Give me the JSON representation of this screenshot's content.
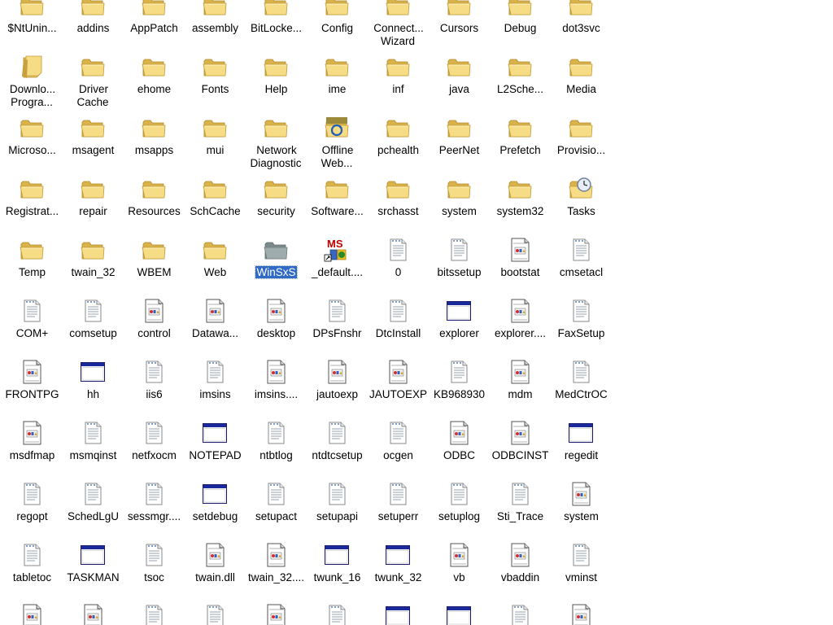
{
  "window": {
    "selected_item": "WinSxS"
  },
  "items": [
    {
      "label": "$NtUnin...",
      "icon": "folder-icon"
    },
    {
      "label": "addins",
      "icon": "folder-icon"
    },
    {
      "label": "AppPatch",
      "icon": "folder-icon"
    },
    {
      "label": "assembly",
      "icon": "folder-icon"
    },
    {
      "label": "BitLocke...",
      "icon": "folder-icon"
    },
    {
      "label": "Config",
      "icon": "folder-icon"
    },
    {
      "label": "Connect... Wizard",
      "icon": "folder-icon"
    },
    {
      "label": "Cursors",
      "icon": "folder-icon"
    },
    {
      "label": "Debug",
      "icon": "folder-icon"
    },
    {
      "label": "dot3svc",
      "icon": "folder-icon"
    },
    {
      "label": "Downlo... Progra...",
      "icon": "special-folder-icon"
    },
    {
      "label": "Driver Cache",
      "icon": "folder-icon"
    },
    {
      "label": "ehome",
      "icon": "folder-icon"
    },
    {
      "label": "Fonts",
      "icon": "folder-icon"
    },
    {
      "label": "Help",
      "icon": "folder-icon"
    },
    {
      "label": "ime",
      "icon": "folder-icon"
    },
    {
      "label": "inf",
      "icon": "folder-icon"
    },
    {
      "label": "java",
      "icon": "folder-icon"
    },
    {
      "label": "L2Sche...",
      "icon": "folder-icon"
    },
    {
      "label": "Media",
      "icon": "folder-icon"
    },
    {
      "label": "Microso...",
      "icon": "folder-icon"
    },
    {
      "label": "msagent",
      "icon": "folder-icon"
    },
    {
      "label": "msapps",
      "icon": "folder-icon"
    },
    {
      "label": "mui",
      "icon": "folder-icon"
    },
    {
      "label": "Network Diagnostic",
      "icon": "folder-icon"
    },
    {
      "label": "Offline Web...",
      "icon": "offline-web-folder-icon"
    },
    {
      "label": "pchealth",
      "icon": "folder-icon"
    },
    {
      "label": "PeerNet",
      "icon": "folder-icon"
    },
    {
      "label": "Prefetch",
      "icon": "folder-icon"
    },
    {
      "label": "Provisio...",
      "icon": "folder-icon"
    },
    {
      "label": "Registrat...",
      "icon": "folder-icon"
    },
    {
      "label": "repair",
      "icon": "folder-icon"
    },
    {
      "label": "Resources",
      "icon": "folder-icon"
    },
    {
      "label": "SchCache",
      "icon": "folder-icon"
    },
    {
      "label": "security",
      "icon": "folder-icon"
    },
    {
      "label": "Software...",
      "icon": "folder-icon"
    },
    {
      "label": "srchasst",
      "icon": "folder-icon"
    },
    {
      "label": "system",
      "icon": "folder-icon"
    },
    {
      "label": "system32",
      "icon": "folder-icon"
    },
    {
      "label": "Tasks",
      "icon": "scheduled-tasks-folder-icon"
    },
    {
      "label": "Temp",
      "icon": "folder-icon"
    },
    {
      "label": "twain_32",
      "icon": "folder-icon"
    },
    {
      "label": "WBEM",
      "icon": "folder-icon"
    },
    {
      "label": "Web",
      "icon": "folder-icon"
    },
    {
      "label": "WinSxS",
      "icon": "gray-folder-icon"
    },
    {
      "label": "_default....",
      "icon": "msi-package-icon"
    },
    {
      "label": "0",
      "icon": "text-file-icon"
    },
    {
      "label": "bitssetup",
      "icon": "text-file-icon"
    },
    {
      "label": "bootstat",
      "icon": "system-file-icon"
    },
    {
      "label": "cmsetacl",
      "icon": "text-file-icon"
    },
    {
      "label": "COM+",
      "icon": "text-file-icon"
    },
    {
      "label": "comsetup",
      "icon": "text-file-icon"
    },
    {
      "label": "control",
      "icon": "system-file-icon"
    },
    {
      "label": "Datawa...",
      "icon": "system-file-icon"
    },
    {
      "label": "desktop",
      "icon": "system-file-icon"
    },
    {
      "label": "DPsFnshr",
      "icon": "text-file-icon"
    },
    {
      "label": "DtcInstall",
      "icon": "text-file-icon"
    },
    {
      "label": "explorer",
      "icon": "application-icon"
    },
    {
      "label": "explorer....",
      "icon": "system-file-icon"
    },
    {
      "label": "FaxSetup",
      "icon": "text-file-icon"
    },
    {
      "label": "FRONTPG",
      "icon": "system-file-icon"
    },
    {
      "label": "hh",
      "icon": "application-icon"
    },
    {
      "label": "iis6",
      "icon": "text-file-icon"
    },
    {
      "label": "imsins",
      "icon": "text-file-icon"
    },
    {
      "label": "imsins....",
      "icon": "system-file-icon"
    },
    {
      "label": "jautoexp",
      "icon": "system-file-icon"
    },
    {
      "label": "JAUTOEXP",
      "icon": "system-file-icon"
    },
    {
      "label": "KB968930",
      "icon": "text-file-icon"
    },
    {
      "label": "mdm",
      "icon": "system-file-icon"
    },
    {
      "label": "MedCtrOC",
      "icon": "text-file-icon"
    },
    {
      "label": "msdfmap",
      "icon": "system-file-icon"
    },
    {
      "label": "msmqinst",
      "icon": "text-file-icon"
    },
    {
      "label": "netfxocm",
      "icon": "text-file-icon"
    },
    {
      "label": "NOTEPAD",
      "icon": "application-icon"
    },
    {
      "label": "ntbtlog",
      "icon": "text-file-icon"
    },
    {
      "label": "ntdtcsetup",
      "icon": "text-file-icon"
    },
    {
      "label": "ocgen",
      "icon": "text-file-icon"
    },
    {
      "label": "ODBC",
      "icon": "system-file-icon"
    },
    {
      "label": "ODBCINST",
      "icon": "system-file-icon"
    },
    {
      "label": "regedit",
      "icon": "application-icon"
    },
    {
      "label": "regopt",
      "icon": "text-file-icon"
    },
    {
      "label": "SchedLgU",
      "icon": "text-file-icon"
    },
    {
      "label": "sessmgr....",
      "icon": "text-file-icon"
    },
    {
      "label": "setdebug",
      "icon": "application-icon"
    },
    {
      "label": "setupact",
      "icon": "text-file-icon"
    },
    {
      "label": "setupapi",
      "icon": "text-file-icon"
    },
    {
      "label": "setuperr",
      "icon": "text-file-icon"
    },
    {
      "label": "setuplog",
      "icon": "text-file-icon"
    },
    {
      "label": "Sti_Trace",
      "icon": "text-file-icon"
    },
    {
      "label": "system",
      "icon": "system-file-icon"
    },
    {
      "label": "tabletoc",
      "icon": "text-file-icon"
    },
    {
      "label": "TASKMAN",
      "icon": "application-icon"
    },
    {
      "label": "tsoc",
      "icon": "text-file-icon"
    },
    {
      "label": "twain.dll",
      "icon": "system-file-icon"
    },
    {
      "label": "twain_32....",
      "icon": "system-file-icon"
    },
    {
      "label": "twunk_16",
      "icon": "application-icon"
    },
    {
      "label": "twunk_32",
      "icon": "application-icon"
    },
    {
      "label": "vb",
      "icon": "system-file-icon"
    },
    {
      "label": "vbaddin",
      "icon": "system-file-icon"
    },
    {
      "label": "vminst",
      "icon": "text-file-icon"
    },
    {
      "label": "",
      "icon": "system-file-icon"
    },
    {
      "label": "",
      "icon": "system-file-icon"
    },
    {
      "label": "",
      "icon": "text-file-icon"
    },
    {
      "label": "",
      "icon": "text-file-icon"
    },
    {
      "label": "",
      "icon": "system-file-icon"
    },
    {
      "label": "",
      "icon": "text-file-icon"
    },
    {
      "label": "",
      "icon": "application-icon"
    },
    {
      "label": "",
      "icon": "application-icon"
    },
    {
      "label": "",
      "icon": "text-file-icon"
    },
    {
      "label": "",
      "icon": "system-file-icon"
    }
  ]
}
